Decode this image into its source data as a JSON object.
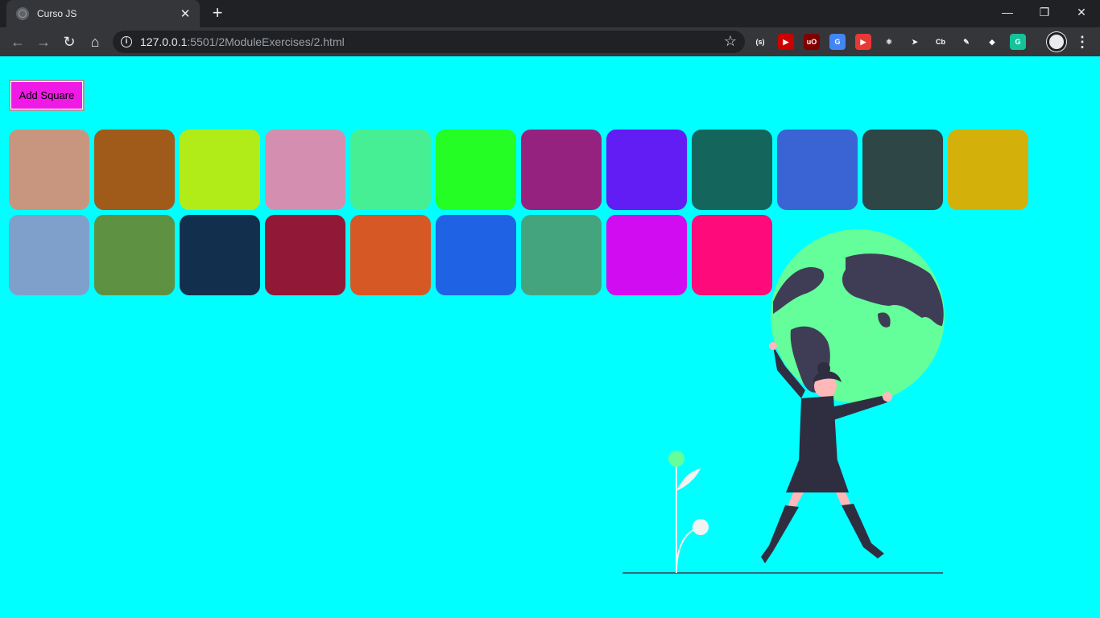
{
  "browser": {
    "tab_title": "Curso JS",
    "new_tab_label": "+",
    "url_host": "127.0.0.1",
    "url_path": ":5501/2ModuleExercises/2.html",
    "window_controls": [
      "minimize-icon",
      "restore-icon",
      "close-icon"
    ],
    "extensions": [
      {
        "name": "sync-extension-icon",
        "label": "(s)",
        "color": "#35363a"
      },
      {
        "name": "youtube-extension-icon",
        "label": "▶",
        "color": "#cc0000"
      },
      {
        "name": "ublock-icon",
        "label": "uO",
        "color": "#800000"
      },
      {
        "name": "google-translate-icon",
        "label": "G",
        "color": "#4285f4"
      },
      {
        "name": "youtube-red-icon",
        "label": "▶",
        "color": "#e53935"
      },
      {
        "name": "react-devtools-icon",
        "label": "⚛",
        "color": "#35363a"
      },
      {
        "name": "arrow-extension-icon",
        "label": "➤",
        "color": "#35363a"
      },
      {
        "name": "cb-extension-icon",
        "label": "Cb",
        "color": "#35363a"
      },
      {
        "name": "pen-extension-icon",
        "label": "✎",
        "color": "#35363a"
      },
      {
        "name": "color-picker-icon",
        "label": "◆",
        "color": "#35363a"
      },
      {
        "name": "grammarly-icon",
        "label": "G",
        "color": "#15c39a"
      }
    ]
  },
  "page": {
    "background": "#00ffff",
    "add_button_label": "Add Square",
    "add_button_color": "#ef1ae6",
    "squares": [
      "#c8967e",
      "#a05a1a",
      "#b2ec18",
      "#d48fb0",
      "#46ef94",
      "#24fe24",
      "#94227e",
      "#621df4",
      "#14665c",
      "#3a64d4",
      "#2e4646",
      "#d4b00a",
      "#80a0cc",
      "#5e9242",
      "#12304e",
      "#921838",
      "#d65824",
      "#2062e4",
      "#44a47e",
      "#d20cf0",
      "#fe0a7a"
    ],
    "illustration": {
      "globe_color": "#64fe9a",
      "land_color": "#3f3d56",
      "person_color": "#2f2e41",
      "skin_color": "#ffb8b8",
      "plant_color": "#f2f2f2"
    }
  }
}
